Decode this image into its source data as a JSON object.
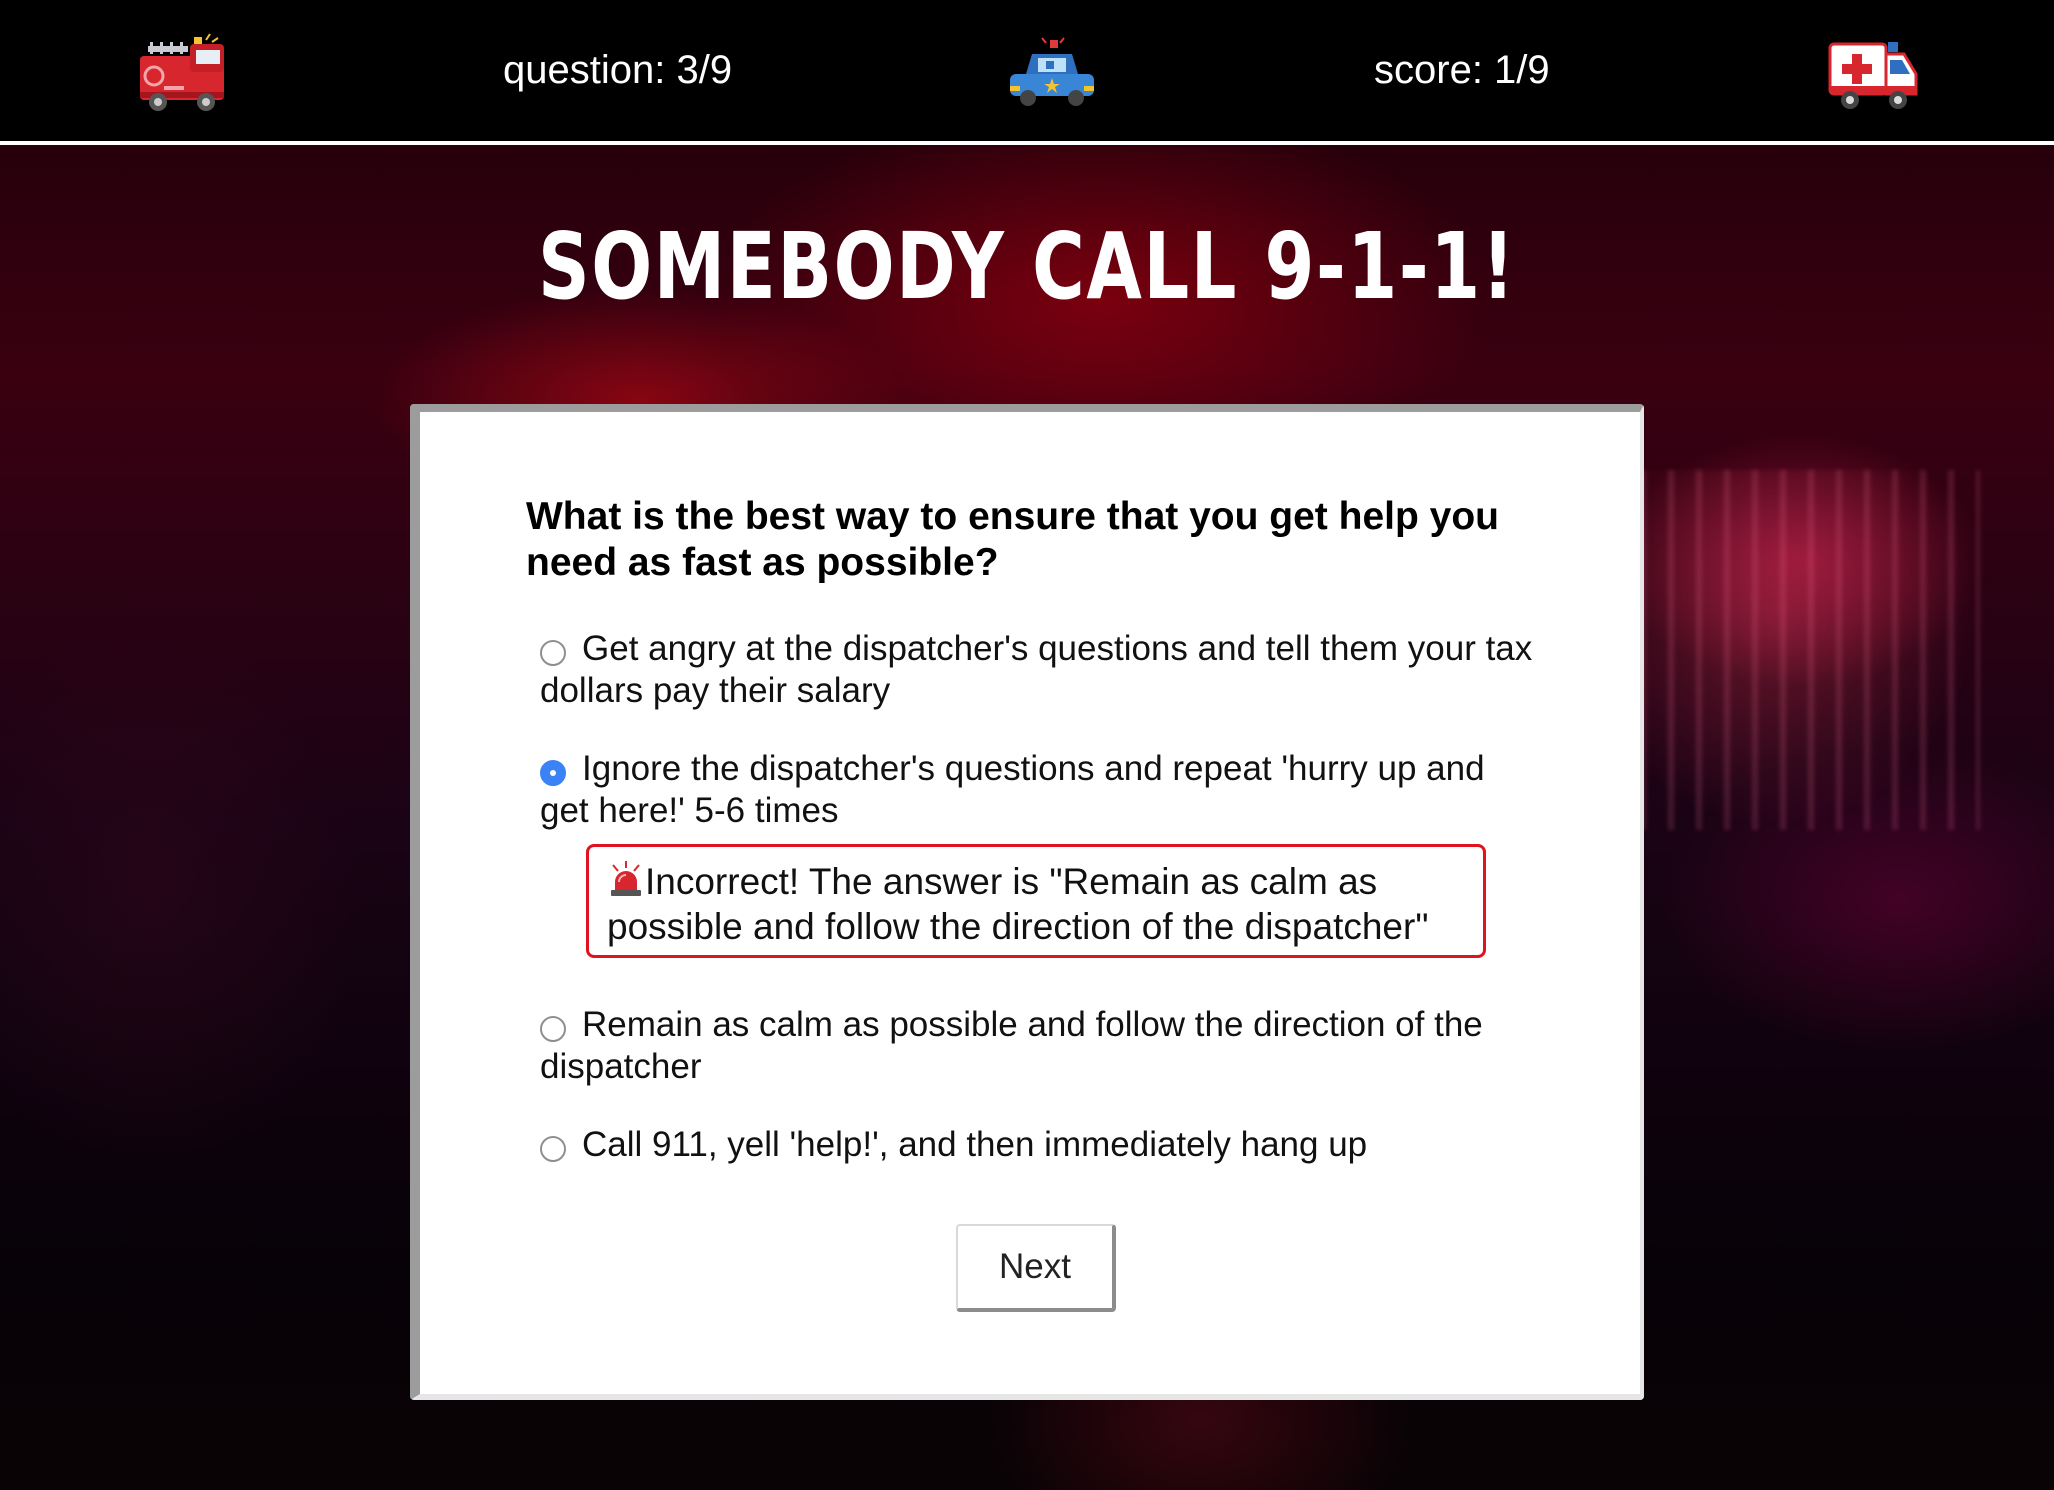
{
  "header": {
    "question_counter": "question: 3/9",
    "score": "score: 1/9",
    "icons": [
      "fire-engine-icon",
      "police-car-icon",
      "ambulance-icon"
    ]
  },
  "title": "SOMEBODY CALL 9-1-1!",
  "quiz": {
    "question": "What is the best way to ensure that you get help you need as fast as possible?",
    "options": [
      {
        "label": "Get angry at the dispatcher's questions and tell them your tax dollars pay their salary",
        "selected": false
      },
      {
        "label": "Ignore the dispatcher's questions and repeat 'hurry up and get here!' 5-6 times",
        "selected": true
      },
      {
        "label": "Remain as calm as possible and follow the direction of the dispatcher",
        "selected": false
      },
      {
        "label": "Call 911, yell 'help!', and then immediately hang up",
        "selected": false
      }
    ],
    "feedback": {
      "icon": "siren-icon",
      "text": "Incorrect! The answer is \"Remain as calm as possible and follow the direction of the dispatcher\""
    },
    "next_label": "Next"
  },
  "colors": {
    "feedback_border": "#e0141e",
    "radio_selected": "#3b82f6",
    "header_bg": "#000000"
  }
}
